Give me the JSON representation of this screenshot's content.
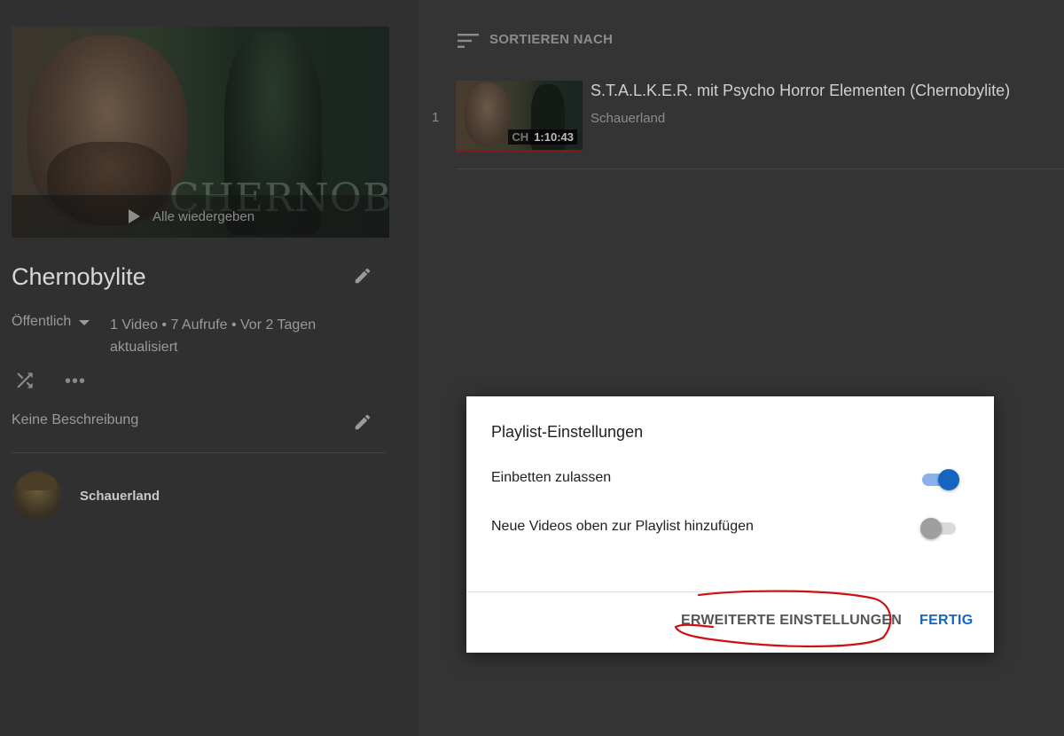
{
  "playlist": {
    "hero_action_label": "Alle wiedergeben",
    "hero_logo_text": "CHERNOBYLITE",
    "title": "Chernobylite",
    "privacy": "Öffentlich",
    "stats": "1 Video • 7 Aufrufe • Vor 2 Tagen aktualisiert",
    "description": "Keine Beschreibung",
    "channel": "Schauerland"
  },
  "list": {
    "sort_label": "SORTIEREN NACH",
    "items": [
      {
        "index": "1",
        "title": "S.T.A.L.K.E.R. mit Psycho Horror Elementen (Chernobylite)",
        "channel": "Schauerland",
        "duration": "1:10:43",
        "thumb_badge": "CH"
      }
    ]
  },
  "dialog": {
    "title": "Playlist-Einstellungen",
    "options": [
      {
        "label": "Einbetten zulassen",
        "enabled": true
      },
      {
        "label": "Neue Videos oben zur Playlist hinzufügen",
        "enabled": false
      }
    ],
    "advanced_button": "ERWEITERTE EINSTELLUNGEN",
    "done_button": "FERTIG"
  },
  "colors": {
    "accent": "#1565c0",
    "annotation": "#d01010"
  }
}
